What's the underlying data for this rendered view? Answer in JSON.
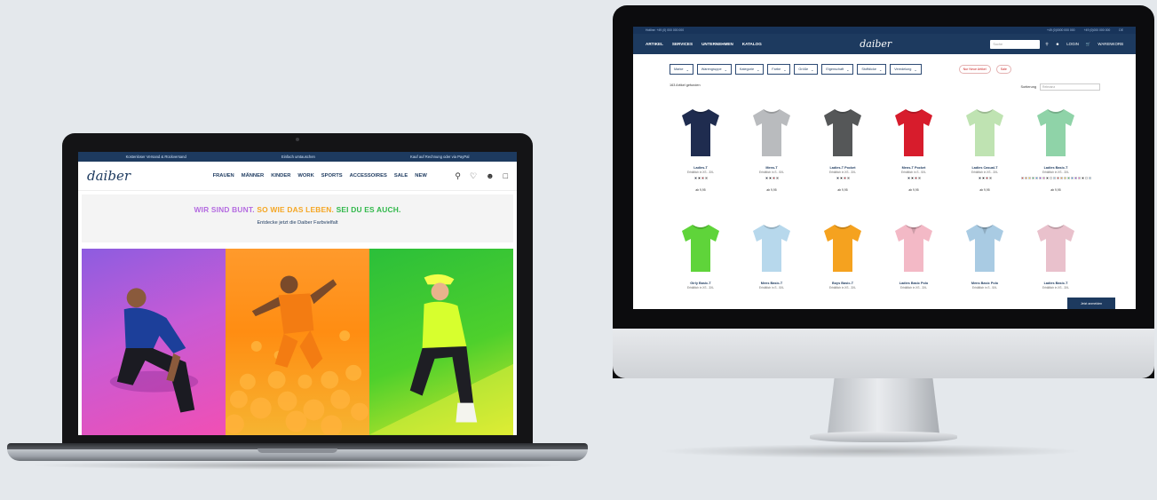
{
  "laptop": {
    "topbar": [
      "Kostenloser Versand & Rückversand",
      "Einfach umtauschen",
      "Kauf auf Rechnung oder via PayPal"
    ],
    "logo": "daiber",
    "menu": [
      "FRAUEN",
      "MÄNNER",
      "KINDER",
      "WORK",
      "SPORTS",
      "ACCESSOIRES",
      "SALE",
      "NEW"
    ],
    "icons": [
      "search-icon",
      "heart-icon",
      "user-icon",
      "bag-icon"
    ],
    "headline_part1": "WIR SIND BUNT.",
    "headline_part2": " SO WIE DAS LEBEN.",
    "headline_part3": " SEI DU ES AUCH.",
    "subline": "Entdecke jetzt die Daiber Farbvielfalt",
    "photos": [
      "pink-purple",
      "orange",
      "green"
    ]
  },
  "imac": {
    "topbar_left": "Hotline: +49 (0) 000 000 000",
    "topbar_right": [
      "+49 (0)0000 000 000",
      "+49 (0)000 000 000",
      "DE"
    ],
    "menu": [
      "ARTIKEL",
      "SERVICES",
      "UNTERNEHMEN",
      "KATALOG"
    ],
    "logo": "daiber",
    "search_placeholder": "Suche",
    "login": "LOGIN",
    "cart": "WARENKORB",
    "filters": [
      "Marke",
      "Warengruppe",
      "Kategorie",
      "Farbe",
      "Größe",
      "Eigenschaft",
      "Stoffdicke",
      "Veredelung"
    ],
    "tags": [
      "Nur Neue Artikel",
      "Sale"
    ],
    "results": "163 Artikel gefunden",
    "sort_label": "Sortierung",
    "sort_value": "Relevanz",
    "products": [
      {
        "name": "Ladies-T",
        "detail": "Erhältlich in XS - 3XL",
        "color": "#1f2c4f",
        "price": "ab 9,95"
      },
      {
        "name": "Mens-T",
        "detail": "Erhältlich in S - 5XL",
        "color": "#b9bbbe",
        "price": "ab 9,95"
      },
      {
        "name": "Ladies-T Pocket",
        "detail": "Erhältlich in XS - 3XL",
        "color": "#555758",
        "price": "ab 9,95"
      },
      {
        "name": "Mens-T Pocket",
        "detail": "Erhältlich in S - 5XL",
        "color": "#d71c2c",
        "price": "ab 9,95"
      },
      {
        "name": "Ladies Casual-T",
        "detail": "Erhältlich in XS - 3XL",
        "color": "#bfe3b2",
        "price": "ab 9,95"
      },
      {
        "name": "Ladies Basic-T",
        "detail": "Erhältlich in XS - 3XL",
        "color": "#8fd3a8",
        "price": "ab 9,95"
      },
      {
        "name": "Girly Basic-T",
        "detail": "Erhältlich in XS - 3XL",
        "color": "#5fd43a",
        "price": ""
      },
      {
        "name": "Mens Basic-T",
        "detail": "Erhältlich in S - 5XL",
        "color": "#b7d8ec",
        "price": ""
      },
      {
        "name": "Boys Basic-T",
        "detail": "Erhältlich in XS - 3XL",
        "color": "#f5a21f",
        "price": ""
      },
      {
        "name": "Ladies Basic Polo",
        "detail": "Erhältlich in XS - 3XL",
        "color": "#f3b9c6",
        "price": ""
      },
      {
        "name": "Mens Basic Polo",
        "detail": "Erhältlich in S - 5XL",
        "color": "#a9cbe3",
        "price": ""
      },
      {
        "name": "Ladies Basic-T",
        "detail": "Erhältlich in XS - 3XL",
        "color": "#e9c1cc",
        "price": ""
      }
    ],
    "cta": "Jetzt anmelden"
  }
}
